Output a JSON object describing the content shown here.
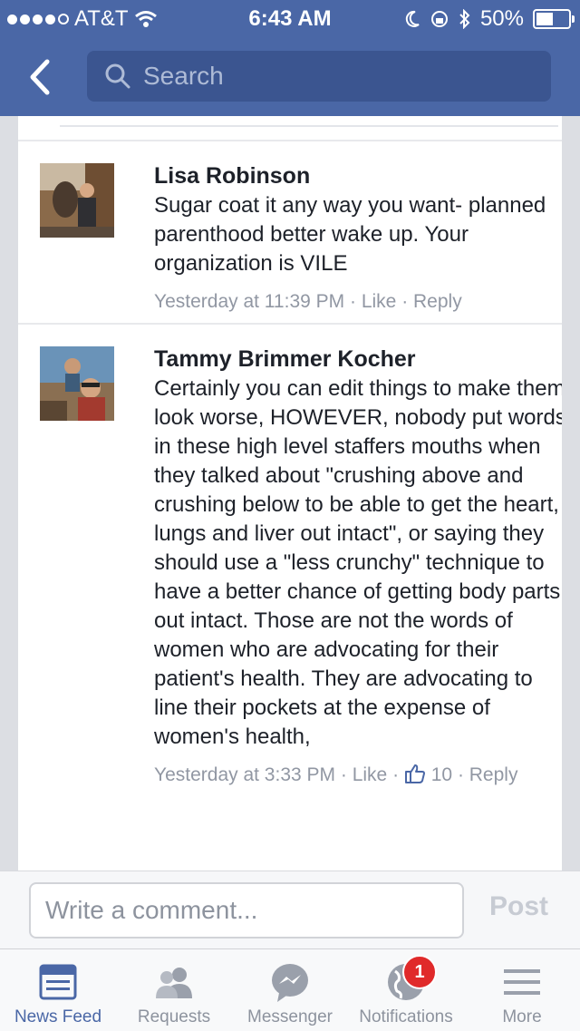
{
  "status_bar": {
    "carrier": "AT&T",
    "time": "6:43 AM",
    "battery": "50%"
  },
  "header": {
    "search_placeholder": "Search"
  },
  "comments": [
    {
      "name": "Lisa Robinson",
      "text": "Sugar coat it any way you want- planned parenthood better wake up. Your organization is VILE",
      "timestamp": "Yesterday at 11:39 PM",
      "like_label": "Like",
      "reply_label": "Reply"
    },
    {
      "name": "Tammy Brimmer Kocher",
      "text": "Certainly you can edit things to make them look worse, HOWEVER, nobody put words in these high level staffers mouths when they talked about \"crushing above and crushing below to be able to get the heart, lungs and liver out intact\", or saying they should use a \"less crunchy\" technique to have a better chance of getting body parts out intact. Those are not the words of women who are advocating for their patient's health. They are advocating to line their pockets at the expense of women's health,",
      "timestamp": "Yesterday at 3:33 PM",
      "like_label": "Like",
      "like_count": "10",
      "reply_label": "Reply"
    }
  ],
  "composer": {
    "placeholder": "Write a comment...",
    "post_label": "Post"
  },
  "tabs": [
    {
      "label": "News Feed",
      "icon": "news-feed-icon",
      "active": true
    },
    {
      "label": "Requests",
      "icon": "friend-requests-icon"
    },
    {
      "label": "Messenger",
      "icon": "messenger-icon"
    },
    {
      "label": "Notifications",
      "icon": "globe-icon",
      "badge": "1"
    },
    {
      "label": "More",
      "icon": "menu-icon"
    }
  ],
  "colors": {
    "brand": "#4a67a6",
    "badge": "#e02a2a"
  }
}
